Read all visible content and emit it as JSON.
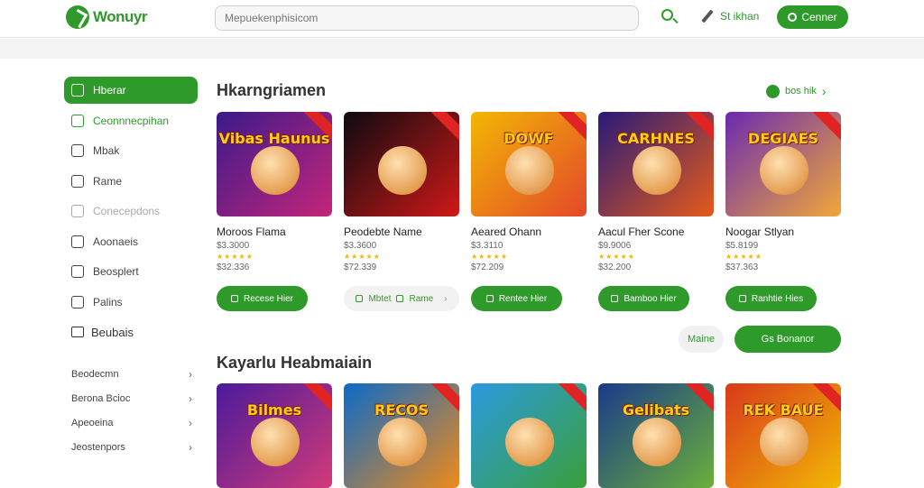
{
  "header": {
    "logo_text": "Wonuyr",
    "search_placeholder": "Mepuekenphisicom",
    "signin_label": "St ikhan",
    "connect_label": "Cenner"
  },
  "sidebar": {
    "items": [
      {
        "label": "Hberar"
      },
      {
        "label": "Ceonnnecpihan"
      },
      {
        "label": "Mbak"
      },
      {
        "label": "Rame"
      },
      {
        "label": "Conecepdons"
      },
      {
        "label": "Aoonaeis"
      },
      {
        "label": "Beosplert"
      },
      {
        "label": "Palins"
      }
    ],
    "section_label": "Beubais",
    "links": [
      {
        "label": "Beodecmn"
      },
      {
        "label": "Berona Bcioc"
      },
      {
        "label": "Apeoeina"
      },
      {
        "label": "Jeostenpors"
      }
    ]
  },
  "main": {
    "section1_title": "Hkarngriamen",
    "see_more_label": "bos hik",
    "section2_title": "Kayarlu Heabmaiain",
    "more_button": "Maine",
    "all_button": "Gs Bonanor",
    "row1": [
      {
        "thumb_title": "Vibas Haunus",
        "name": "Moroos Flama",
        "meta": "$3.3000",
        "price": "$32.336",
        "button": "Recese Hier",
        "colors": [
          "#3a1a8a",
          "#c5257a"
        ]
      },
      {
        "thumb_title": "",
        "name": "Peodebte Name",
        "meta": "$3.3600",
        "price": "$72.339",
        "button": "Mbtet",
        "button_secondary": "Rame",
        "colors": [
          "#0b0b10",
          "#d01818"
        ]
      },
      {
        "thumb_title": "DOWF",
        "name": "Aeared Ohann",
        "meta": "$3.3110",
        "price": "$72.209",
        "button": "Rentee Hier",
        "colors": [
          "#f2b705",
          "#e4472a"
        ]
      },
      {
        "thumb_title": "CARHNES",
        "name": "Aacul Fher Scone",
        "meta": "$9.9006",
        "price": "$32.200",
        "button": "Bamboo Hier",
        "colors": [
          "#281a7a",
          "#e65a1a"
        ]
      },
      {
        "thumb_title": "DEGIAES",
        "name": "Noogar Stlyan",
        "meta": "$5.8199",
        "price": "$37.363",
        "button": "Ranhtie Hies",
        "colors": [
          "#6a2ab0",
          "#f0a83a"
        ]
      }
    ],
    "row2": [
      {
        "thumb_title": "Bilmes",
        "colors": [
          "#4a1a9a",
          "#d23a7a"
        ]
      },
      {
        "thumb_title": "RECOS",
        "colors": [
          "#0a6ac8",
          "#f08a1a"
        ]
      },
      {
        "thumb_title": "",
        "colors": [
          "#2a9ae0",
          "#3aa03a"
        ]
      },
      {
        "thumb_title": "Gelibats",
        "colors": [
          "#1a3a8a",
          "#6ab03a"
        ]
      },
      {
        "thumb_title": "REK BAUE",
        "colors": [
          "#d83a1a",
          "#f2b705"
        ]
      }
    ]
  }
}
